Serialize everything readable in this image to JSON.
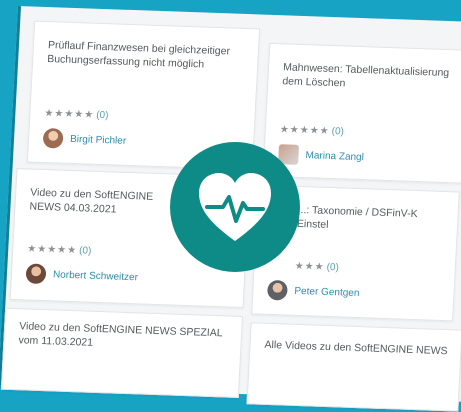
{
  "cards": [
    {
      "title": "Prüflauf Finanzwesen bei gleichzeitiger Buchungserfassung nicht möglich",
      "stars": "★★★★★",
      "count": "(0)",
      "author": "Birgit Pichler"
    },
    {
      "title": "Mahnwesen: Tabellenaktualisierung dem Löschen",
      "stars": "★★★★★",
      "count": "(0)",
      "author": "Marina Zangl"
    },
    {
      "title": "Video zu den SoftENGINE NEWS 04.03.2021",
      "stars": "★★★★★",
      "count": "(0)",
      "author": "Norbert Schweitzer"
    },
    {
      "title": "...: Taxonomie / DSFinV-K Einstel",
      "stars": "★★★",
      "count": "(0)",
      "author": "Peter Gentgen"
    },
    {
      "title": "Video zu den SoftENGINE NEWS SPEZIAL vom 11.03.2021",
      "stars": "",
      "count": "",
      "author": ""
    },
    {
      "title": "Alle Videos zu den SoftENGINE NEWS",
      "stars": "",
      "count": "",
      "author": ""
    }
  ],
  "badge": {
    "icon": "heart-pulse-icon",
    "color": "#0f8b87"
  },
  "colors": {
    "background": "#16a3c4",
    "link": "#2d8ca9"
  }
}
